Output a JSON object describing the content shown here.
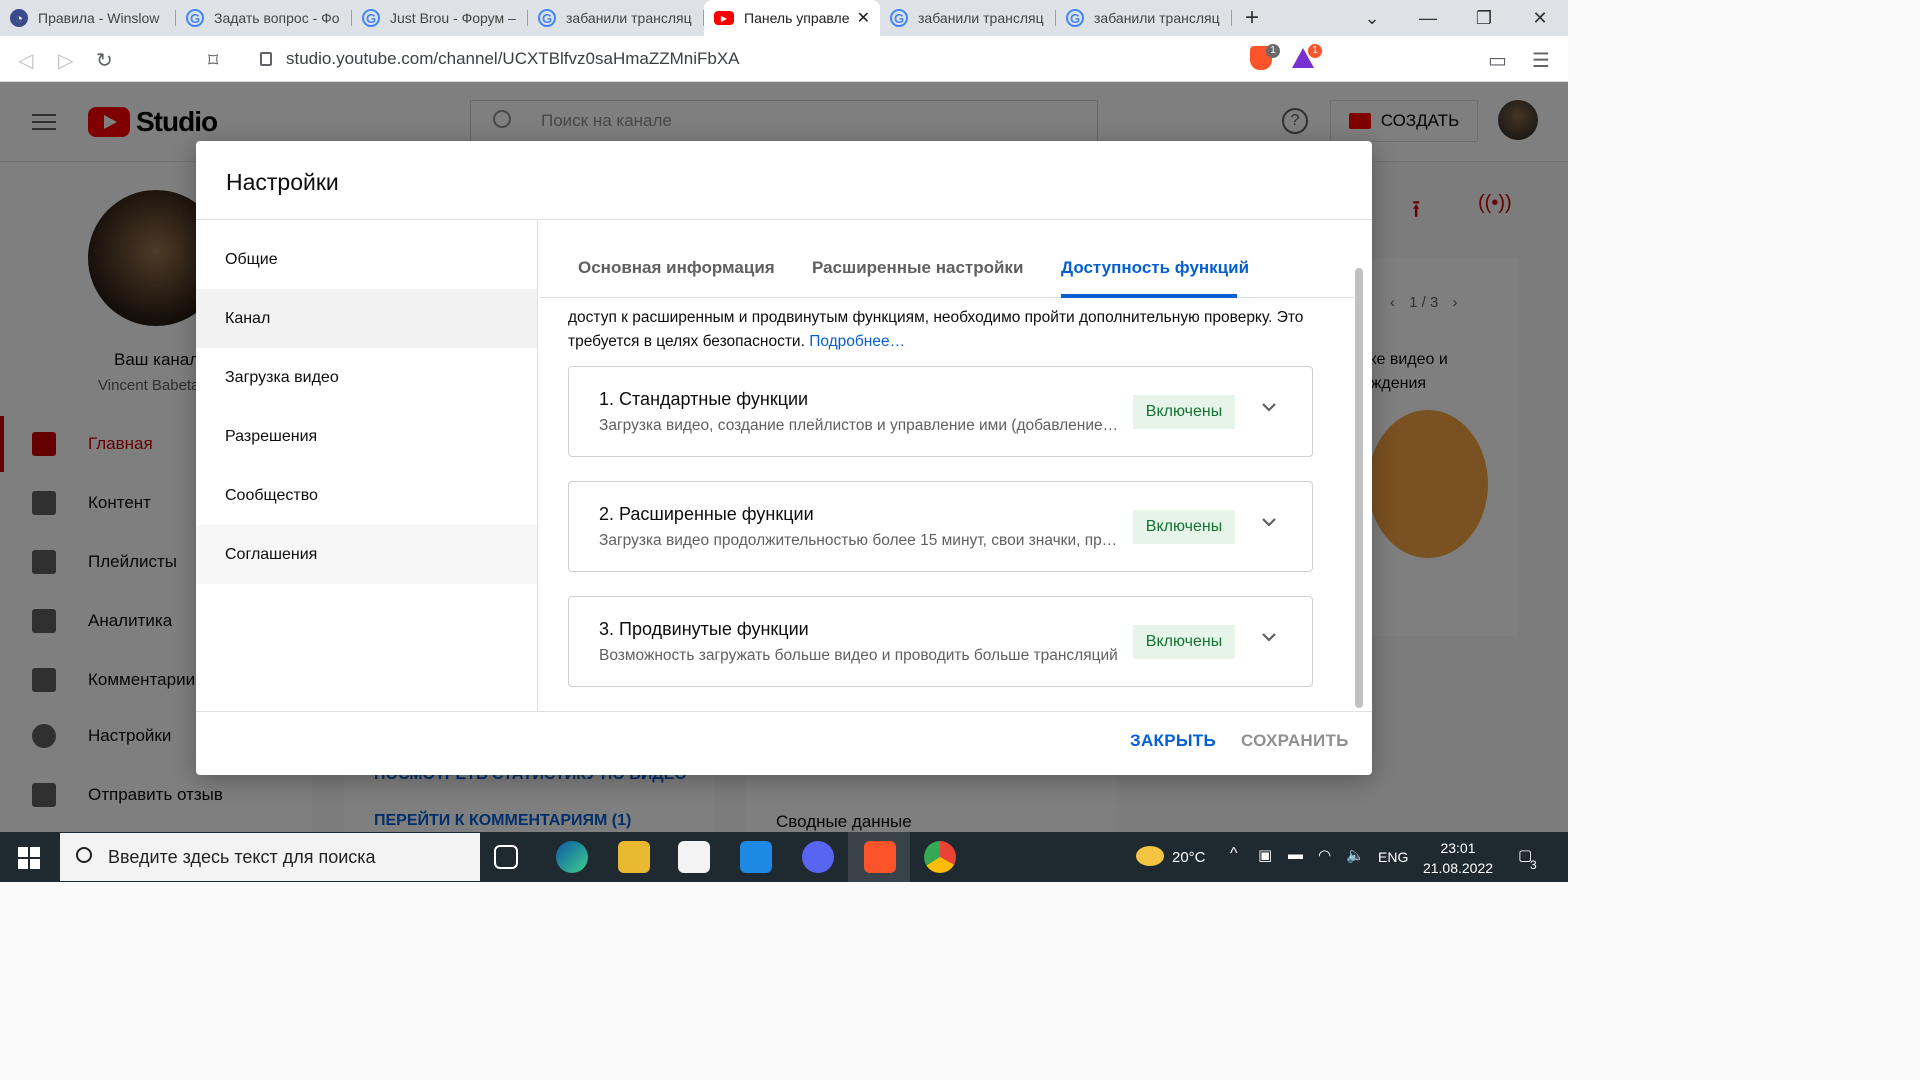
{
  "browser": {
    "tabs": [
      {
        "title": "Правила - Winslow",
        "icon": "site-icon",
        "color": "#3b4a8c"
      },
      {
        "title": "Задать вопрос - Фо",
        "icon": "google-icon",
        "color": "#4285f4"
      },
      {
        "title": "Just Brou - Форум –",
        "icon": "google-icon",
        "color": "#4285f4"
      },
      {
        "title": "забанили трансляц",
        "icon": "google-icon",
        "color": "#4285f4"
      },
      {
        "title": "Панель управле",
        "icon": "youtube-icon",
        "color": "#ff0000"
      },
      {
        "title": "забанили трансляц",
        "icon": "google-icon",
        "color": "#4285f4"
      },
      {
        "title": "забанили трансляц",
        "icon": "google-icon",
        "color": "#4285f4"
      }
    ],
    "url": "studio.youtube.com/channel/UCXTBlfvz0saHmaZZMniFbXA",
    "brave_badge": "1",
    "rewards_badge": "1"
  },
  "studio": {
    "logo_text": "Studio",
    "search_placeholder": "Поиск на канале",
    "create_label": "СОЗДАТЬ",
    "channel_label": "Ваш канал",
    "channel_name": "Vincent Babeta",
    "sidebar": [
      {
        "label": "Главная"
      },
      {
        "label": "Контент"
      },
      {
        "label": "Плейлисты"
      },
      {
        "label": "Аналитика"
      },
      {
        "label": "Комментарии"
      },
      {
        "label": "Настройки"
      },
      {
        "label": "Отправить отзыв"
      }
    ],
    "bg_link_1": "ПОСМОТРЕТЬ СТАТИСТИКУ ПО ВИДЕО",
    "bg_link_2": "ПЕРЕЙТИ К КОММЕНТАРИЯМ (1)",
    "bg_heading": "Сводные данные",
    "bg_pager": "1 / 3",
    "bg_card_text_1": "тке видео и",
    "bg_card_text_2": "ождения"
  },
  "dialog": {
    "title": "Настройки",
    "nav": [
      {
        "label": "Общие"
      },
      {
        "label": "Канал"
      },
      {
        "label": "Загрузка видео"
      },
      {
        "label": "Разрешения"
      },
      {
        "label": "Сообщество"
      },
      {
        "label": "Соглашения"
      }
    ],
    "tabs": [
      {
        "label": "Основная информация"
      },
      {
        "label": "Расширенные настройки"
      },
      {
        "label": "Доступность функций"
      }
    ],
    "intro_text": "доступ к расширенным и продвинутым функциям, необходимо пройти дополнительную проверку. Это требуется в целях безопасности.",
    "learn_more": "Подробнее…",
    "features": [
      {
        "title": "1. Стандартные функции",
        "desc": "Загрузка видео, создание плейлистов и управление ими (добавление видео",
        "status": "Включены"
      },
      {
        "title": "2. Расширенные функции",
        "desc": "Загрузка видео продолжительностью более 15 минут, свои значки, прямые трансляции",
        "status": "Включены"
      },
      {
        "title": "3. Продвинутые функции",
        "desc": "Возможность загружать больше видео и проводить больше трансляций",
        "status": "Включены"
      }
    ],
    "close_label": "ЗАКРЫТЬ",
    "save_label": "СОХРАНИТЬ"
  },
  "taskbar": {
    "search_placeholder": "Введите здесь текст для поиска",
    "weather": "20°C",
    "lang": "ENG",
    "time": "23:01",
    "date": "21.08.2022",
    "notifications": "3"
  },
  "colors": {
    "accent": "#065fd4",
    "enabled_bg": "#e6f4ea",
    "enabled_fg": "#137333",
    "yt_red": "#ff0000"
  }
}
